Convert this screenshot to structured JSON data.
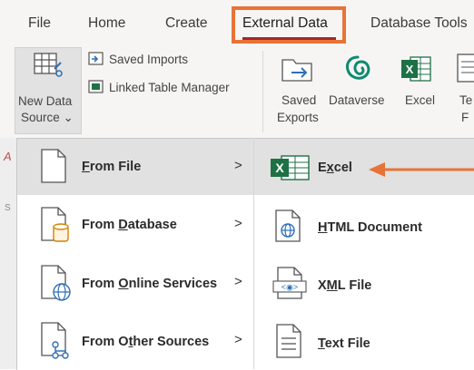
{
  "tabs": [
    "File",
    "Home",
    "Create",
    "External Data",
    "Database Tools"
  ],
  "ribbon": {
    "new_data_source": [
      "New Data",
      "Source ⌄"
    ],
    "saved_imports": "Saved Imports",
    "linked_table_manager": "Linked Table Manager",
    "saved_exports": [
      "Saved",
      "Exports"
    ],
    "dataverse": "Dataverse",
    "excel": "Excel",
    "truncated": [
      "Te",
      "F"
    ]
  },
  "menu": {
    "left": [
      {
        "label": "From File",
        "underline": "F",
        "highlighted": true
      },
      {
        "label": "From Database",
        "underline": "D",
        "highlighted": false
      },
      {
        "label": "From Online Services",
        "underline": "O",
        "highlighted": false
      },
      {
        "label": "From Other Sources",
        "underline": "t",
        "highlighted": false
      }
    ],
    "right": [
      {
        "label": "Excel",
        "underline": "x",
        "highlighted": true
      },
      {
        "label": "HTML Document",
        "underline": "H",
        "highlighted": false
      },
      {
        "label": "XML File",
        "underline": "M",
        "highlighted": false
      },
      {
        "label": "Text File",
        "underline": "T",
        "highlighted": false
      }
    ],
    "chevron": ">"
  },
  "doc_edge": [
    "A",
    "S"
  ],
  "colors": {
    "accent_box": "#e87336",
    "active_tab_underline": "#a4262c",
    "excel_green": "#1e7145",
    "arrow": "#e87336"
  }
}
